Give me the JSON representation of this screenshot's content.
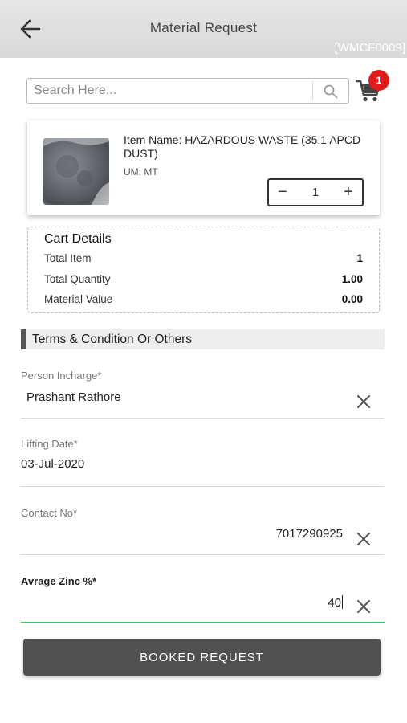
{
  "header": {
    "title": "Material Request",
    "screen_code": "[WMCF0009]",
    "back_icon": "arrow-left-icon"
  },
  "search": {
    "placeholder": "Search Here...",
    "value": "",
    "icon": "search-icon"
  },
  "cart": {
    "icon": "cart-icon",
    "badge_count": "1"
  },
  "item": {
    "name": "Item Name: HAZARDOUS WASTE (35.1 APCD DUST)",
    "um": "UM: MT",
    "quantity": "1",
    "minus_symbol": "−",
    "plus_symbol": "+"
  },
  "cart_details": {
    "title": "Cart Details",
    "rows": [
      {
        "label": "Total Item",
        "value": "1"
      },
      {
        "label": "Total Quantity",
        "value": "1.00"
      },
      {
        "label": "Material Value",
        "value": "0.00"
      }
    ]
  },
  "terms": {
    "title": "Terms & Condition Or Others"
  },
  "form": {
    "person_incharge": {
      "label": "Person Incharge*",
      "value": "Prashant Rathore"
    },
    "lifting_date": {
      "label": "Lifting Date*",
      "value": "03-Jul-2020"
    },
    "contact_no": {
      "label": "Contact No*",
      "value": "7017290925"
    },
    "avg_zinc": {
      "label": "Avrage Zinc %*",
      "value": "40"
    }
  },
  "actions": {
    "booked_request": "BOOKED REQUEST"
  },
  "colors": {
    "appbar": "#dcdcdc",
    "badge": "#e01b1b",
    "focus_underline": "#35c55a",
    "primary_button": "#505050"
  }
}
